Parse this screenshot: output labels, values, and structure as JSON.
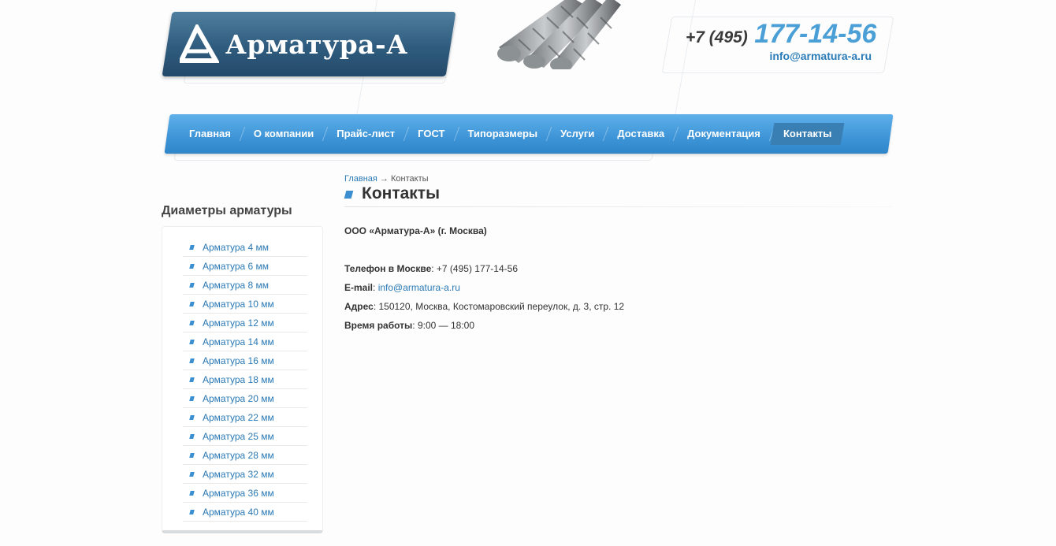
{
  "header": {
    "logo_text": "Арматура-А",
    "phone_code": "+7 (495)",
    "phone_number": "177-14-56",
    "email": "info@armatura-a.ru"
  },
  "nav": {
    "items": [
      {
        "label": "Главная"
      },
      {
        "label": "О компании"
      },
      {
        "label": "Прайс-лист"
      },
      {
        "label": "ГОСТ"
      },
      {
        "label": "Типоразмеры"
      },
      {
        "label": "Услуги"
      },
      {
        "label": "Доставка"
      },
      {
        "label": "Документация"
      },
      {
        "label": "Контакты",
        "active": true
      }
    ]
  },
  "sidebar": {
    "title": "Диаметры арматуры",
    "items": [
      {
        "label": "Арматура 4 мм"
      },
      {
        "label": "Арматура 6 мм"
      },
      {
        "label": "Арматура 8 мм"
      },
      {
        "label": "Арматура 10 мм"
      },
      {
        "label": "Арматура 12 мм"
      },
      {
        "label": "Арматура 14 мм"
      },
      {
        "label": "Арматура 16 мм"
      },
      {
        "label": "Арматура 18 мм"
      },
      {
        "label": "Арматура 20 мм"
      },
      {
        "label": "Арматура 22 мм"
      },
      {
        "label": "Арматура 25 мм"
      },
      {
        "label": "Арматура 28 мм"
      },
      {
        "label": "Арматура 32 мм"
      },
      {
        "label": "Арматура 36 мм"
      },
      {
        "label": "Арматура 40 мм"
      }
    ]
  },
  "breadcrumb": {
    "home": "Главная",
    "separator": "→",
    "current": "Контакты"
  },
  "main": {
    "title": "Контакты",
    "company": "ООО «Арматура-А» (г. Москва)",
    "phone_label": "Телефон в Москве",
    "phone_value": ": +7 (495) 177-14-56",
    "email_label": "E-mail",
    "email_sep": ": ",
    "email_value": "info@armatura-a.ru",
    "address_label": "Адрес",
    "address_value": ": 150120, Москва, Костомаровский переулок, д. 3, стр. 12",
    "hours_label": "Время работы",
    "hours_value": ": 9:00 — 18:00"
  },
  "colors": {
    "accent": "#3d94d6",
    "link": "#2a79b5",
    "logo": "#2f5c7e"
  }
}
